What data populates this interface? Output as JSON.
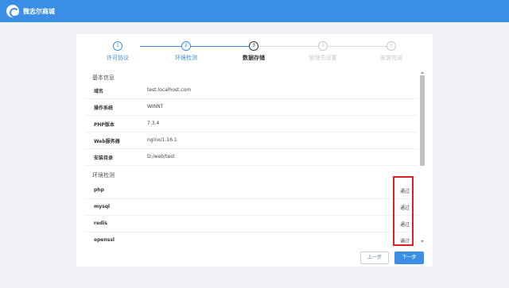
{
  "header": {
    "brand_name": "微志尔商城",
    "logo_icon": "logo-icon",
    "bg_color": "#3a8ee6"
  },
  "steps": [
    {
      "num": "1",
      "label": "许可协议",
      "state": "done"
    },
    {
      "num": "2",
      "label": "环境检测",
      "state": "done"
    },
    {
      "num": "3",
      "label": "数据存储",
      "state": "active"
    },
    {
      "num": "4",
      "label": "管理员设置",
      "state": "pending"
    },
    {
      "num": "5",
      "label": "安装完成",
      "state": "pending"
    }
  ],
  "basic_info": {
    "title": "基本信息",
    "rows": [
      {
        "key": "域名",
        "value": "test.localhost.com"
      },
      {
        "key": "操作系统",
        "value": "WINNT"
      },
      {
        "key": "PHP版本",
        "value": "7.3.4"
      },
      {
        "key": "Web服务器",
        "value": "nginx/1.16.1"
      },
      {
        "key": "安装目录",
        "value": "D:/web/test"
      }
    ]
  },
  "env_check": {
    "title": "环境检测",
    "rows": [
      {
        "key": "php",
        "status": "通过"
      },
      {
        "key": "mysql",
        "status": "通过"
      },
      {
        "key": "redis",
        "status": "通过"
      },
      {
        "key": "openssl",
        "status": "通过"
      }
    ]
  },
  "buttons": {
    "prev": "上一步",
    "next": "下一步"
  },
  "colors": {
    "accent": "#3a8ee6",
    "highlight": "#e02020"
  }
}
